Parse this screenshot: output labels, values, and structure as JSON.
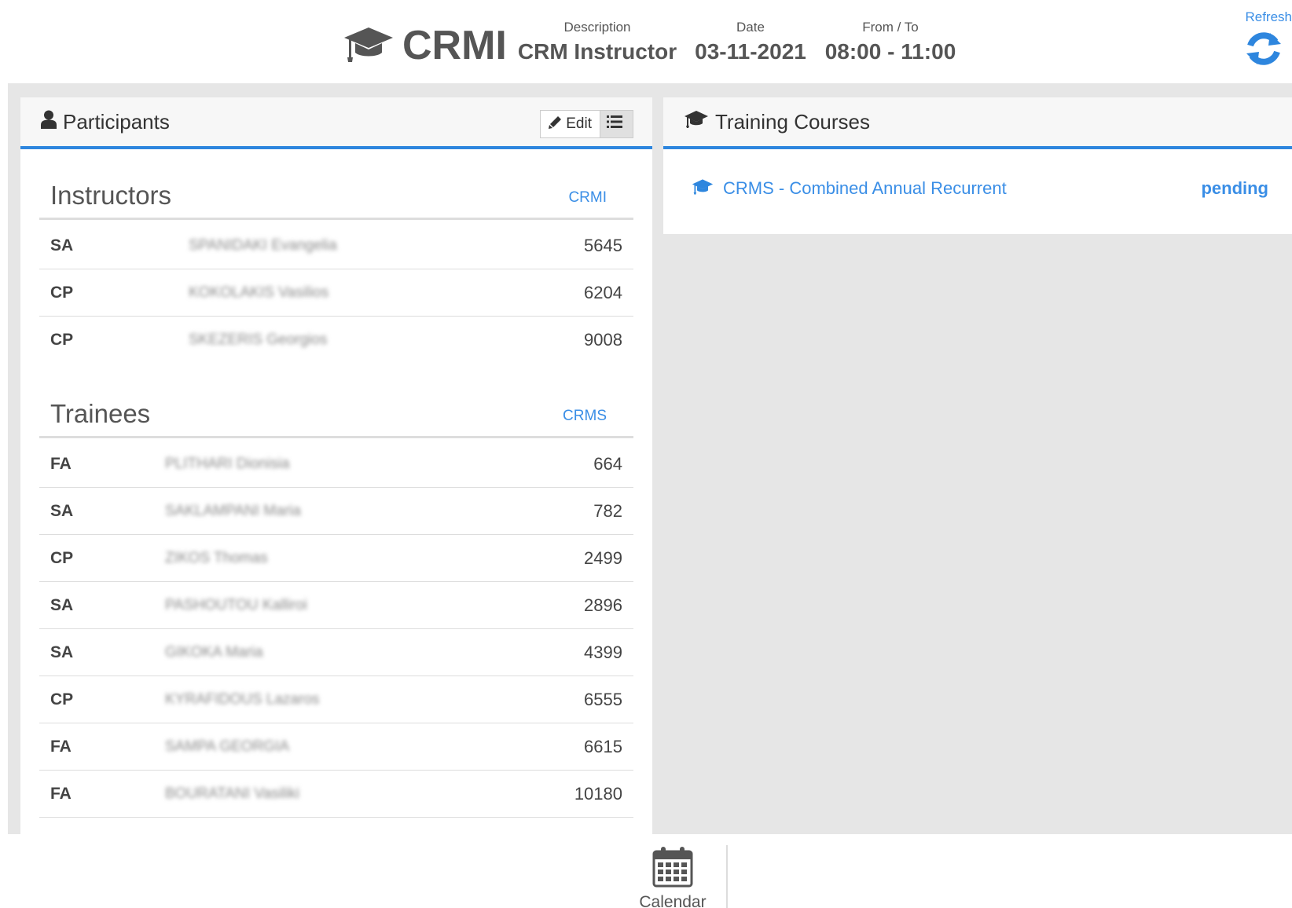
{
  "header": {
    "app_name": "CRMI",
    "description_label": "Description",
    "description_value": "CRM Instructor",
    "date_label": "Date",
    "date_value": "03-11-2021",
    "time_label": "From / To",
    "time_value": "08:00 - 11:00",
    "refresh_label": "Refresh"
  },
  "participants": {
    "title": "Participants",
    "edit_label": "Edit",
    "instructors": {
      "title": "Instructors",
      "code": "CRMI",
      "rows": [
        {
          "rank": "SA",
          "name": "SPANIDAKI Evangelia",
          "id": "5645"
        },
        {
          "rank": "CP",
          "name": "KOKOLAKIS Vasilios",
          "id": "6204"
        },
        {
          "rank": "CP",
          "name": "SKEZERIS Georgios",
          "id": "9008"
        }
      ]
    },
    "trainees": {
      "title": "Trainees",
      "code": "CRMS",
      "rows": [
        {
          "rank": "FA",
          "name": "PLITHARI Dionisia",
          "id": "664"
        },
        {
          "rank": "SA",
          "name": "SAKLAMPANI Maria",
          "id": "782"
        },
        {
          "rank": "CP",
          "name": "ZIKOS Thomas",
          "id": "2499"
        },
        {
          "rank": "SA",
          "name": "PASHOUTOU Kalliroi",
          "id": "2896"
        },
        {
          "rank": "SA",
          "name": "GIKOKA Maria",
          "id": "4399"
        },
        {
          "rank": "CP",
          "name": "KYRAFIDOUS Lazaros",
          "id": "6555"
        },
        {
          "rank": "FA",
          "name": "SAMPA GEORGIA",
          "id": "6615"
        },
        {
          "rank": "FA",
          "name": "BOURATANI Vasiliki",
          "id": "10180"
        }
      ]
    }
  },
  "courses": {
    "title": "Training Courses",
    "items": [
      {
        "name": "CRMS - Combined Annual Recurrent",
        "status": "pending"
      }
    ]
  },
  "bottom_nav": {
    "calendar_label": "Calendar"
  },
  "colors": {
    "accent": "#2e86de",
    "link": "#3a8ee6",
    "background": "#e6e6e6"
  },
  "icons": {
    "brand": "graduation-cap-icon",
    "refresh": "refresh-icon",
    "participants": "user-icon",
    "edit": "pencil-icon",
    "list": "list-icon",
    "courses": "graduation-cap-icon",
    "calendar": "calendar-icon"
  }
}
